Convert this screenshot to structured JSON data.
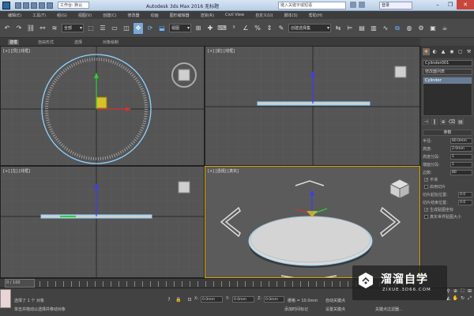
{
  "window": {
    "title": "Autodesk 3ds Max 2016    无标题",
    "workspace": "工作台: 默认",
    "search_placeholder": "键入关键字或短语",
    "help_field": "登录",
    "controls": {
      "minimize": "–",
      "restore": "❐",
      "close": "✕"
    }
  },
  "menu": {
    "items": [
      "编辑(E)",
      "工具(T)",
      "组(G)",
      "视图(V)",
      "创建(C)",
      "修改器",
      "动画",
      "图形编辑器",
      "渲染(R)",
      "Civil View",
      "自定义(U)",
      "脚本(S)",
      "帮助(H)"
    ]
  },
  "toolbar": {
    "filter_select": "全部",
    "refcoord_select": "视图",
    "selection_set": "创建选择集"
  },
  "ribbon": {
    "tabs": [
      {
        "label": "建模",
        "active": true
      },
      {
        "label": "自由形式",
        "active": false
      },
      {
        "label": "选择",
        "active": false
      },
      {
        "label": "对象绘制",
        "active": false
      }
    ]
  },
  "viewports": {
    "top": {
      "label": "[+] [顶] [线框]"
    },
    "front": {
      "label": "[+] [前] [线框]"
    },
    "left": {
      "label": "[+] [左] [线框]"
    },
    "perspective": {
      "label": "[+] [透视] [真实]"
    }
  },
  "command_panel": {
    "tabs": [
      "✱",
      "◐",
      "▲",
      "◉",
      "▢",
      "⚒"
    ],
    "object_name": "Cylinder001",
    "modifier_list": "修改器列表",
    "stack_item": "Cylinder",
    "stack_tools": [
      "⊣",
      "‖",
      "⊕",
      "⌫",
      "▤"
    ],
    "rollout_title": "参数",
    "params": [
      {
        "label": "半径:",
        "value": "80.0mm"
      },
      {
        "label": "高度:",
        "value": "2.0mm"
      },
      {
        "label": "高度分段:",
        "value": "1"
      },
      {
        "label": "端面分段:",
        "value": "1"
      },
      {
        "label": "边数:",
        "value": "80"
      }
    ],
    "smooth_label": "平滑",
    "slice_on_label": "启用切片",
    "slice_from_label": "切片起始位置:",
    "slice_to_label": "切片结束位置:",
    "gen_map_label": "生成贴图坐标",
    "real_world_label": "真实世界贴图大小",
    "slice_from": "0.0",
    "slice_to": "0.0"
  },
  "timeslider": {
    "label": "0 / 100"
  },
  "status": {
    "selected": "选择了 1 个 对象",
    "prompt": "单击并拖动以选择并移动对象",
    "x_label": "X:",
    "x_value": "0.0mm",
    "y_label": "Y:",
    "y_value": "0.0mm",
    "z_label": "Z:",
    "z_value": "0.0mm",
    "grid": "栅格 = 10.0mm",
    "autokey": "自动关键点",
    "setkey": "设置关键点",
    "add_time_tag": "添加时间标记",
    "keyfilter": "关键点过滤器..."
  },
  "watermark": {
    "brand": "溜溜自学",
    "url": "ZIXUE.3D66.COM"
  },
  "colors": {
    "accent_yellow": "#d7a400",
    "selection_cyan": "#8fd3ff",
    "viewport_bg": "#555555"
  }
}
